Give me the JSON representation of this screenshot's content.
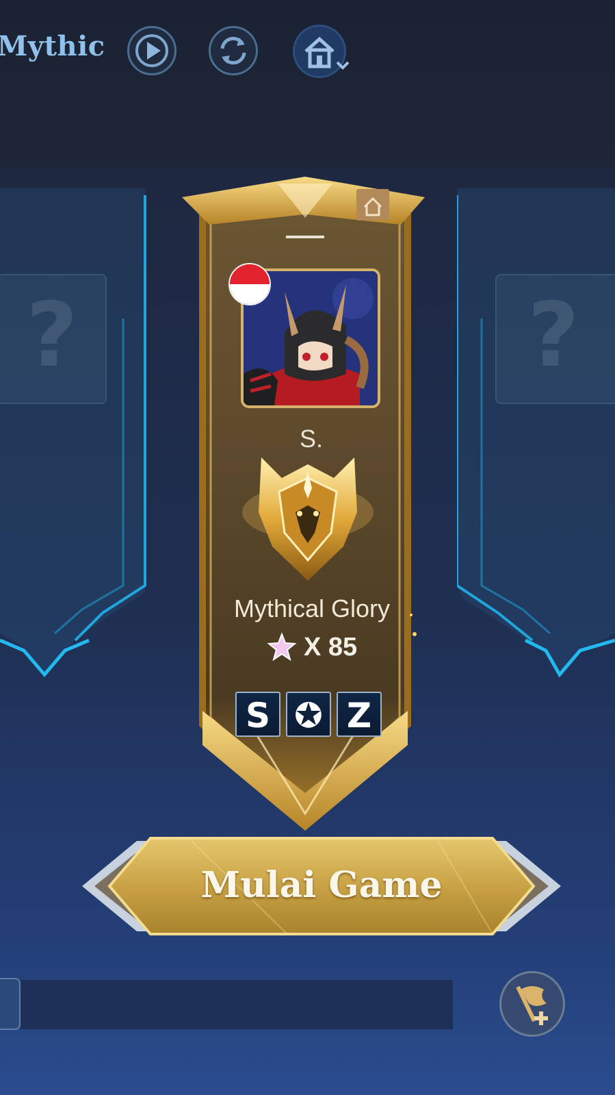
{
  "header": {
    "mode_title": "Mythic",
    "buttons": [
      {
        "name": "play-icon"
      },
      {
        "name": "refresh-icon"
      },
      {
        "name": "home-dropdown-icon"
      }
    ]
  },
  "side_slots": {
    "left_placeholder": "?",
    "right_placeholder": "?"
  },
  "player": {
    "country_flag": "indonesia",
    "name": "S.",
    "rank": "Mythical Glory",
    "star_multiplier": "X 85",
    "badges": [
      {
        "letter": "S",
        "name": "s-badge-icon"
      },
      {
        "letter": "✪",
        "name": "beast-badge-icon"
      },
      {
        "letter": "Z",
        "name": "z-badge-icon"
      }
    ]
  },
  "actions": {
    "start_label": "Mulai Game"
  },
  "colors": {
    "gold": "#d9a93c",
    "title_blue": "#8fc1ec",
    "panel_cyan": "#21b3e6"
  }
}
